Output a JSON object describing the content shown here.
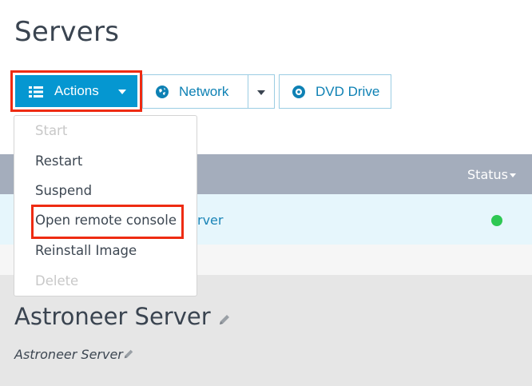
{
  "page": {
    "title": "Servers"
  },
  "toolbar": {
    "actions_label": "Actions",
    "network_label": "Network",
    "dvd_label": "DVD Drive"
  },
  "actions_menu": {
    "items": [
      {
        "label": "Start",
        "disabled": true
      },
      {
        "label": "Restart",
        "disabled": false
      },
      {
        "label": "Suspend",
        "disabled": false
      },
      {
        "label": "Open remote console",
        "disabled": false,
        "highlighted": true
      },
      {
        "label": "Reinstall Image",
        "disabled": false
      },
      {
        "label": "Delete",
        "disabled": true
      }
    ]
  },
  "table": {
    "columns": {
      "status": "Status"
    },
    "rows": [
      {
        "name_visible": "rver",
        "status": "online"
      }
    ]
  },
  "detail": {
    "title": "Astroneer Server",
    "subtitle": "Astroneer Server"
  },
  "colors": {
    "primary": "#0597d1",
    "highlight": "#ee2b12",
    "status_online": "#2ec853",
    "header_bg": "#a4adbc",
    "row_bg": "#e6f6fc"
  },
  "icons": {
    "actions": "list-icon",
    "network": "network-globe-icon",
    "dvd": "disc-icon",
    "edit": "pencil-icon"
  }
}
